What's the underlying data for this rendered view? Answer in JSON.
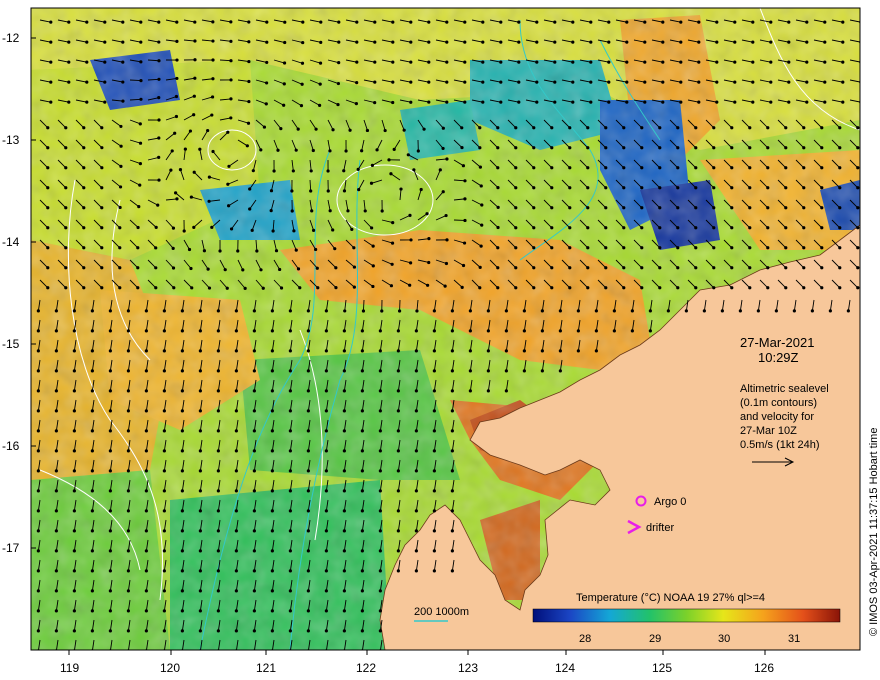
{
  "map": {
    "lat_ticks": [
      "-12",
      "-13",
      "-14",
      "-15",
      "-16",
      "-17"
    ],
    "lon_ticks": [
      "119",
      "120",
      "121",
      "122",
      "123",
      "124",
      "125",
      "126"
    ],
    "date": "27-Mar-2021",
    "time": "10:29Z",
    "sealevel_note": [
      "Altimetric sealevel",
      "(0.1m contours)",
      "and velocity for",
      "27-Mar 10Z",
      "0.5m/s (1kt 24h)"
    ],
    "argo_label": "Argo 0",
    "drifter_label": "drifter",
    "depth_label": "200  1000m",
    "colorbar": {
      "title": "Temperature (°C) NOAA 19 27% ql>=4",
      "ticks": [
        "28",
        "29",
        "30",
        "31"
      ]
    },
    "credit": "© IMOS 03-Apr-2021 11:37:15 Hobart time"
  },
  "colors": {
    "land": "#f7c79a",
    "warm": "#f08a1c",
    "cool": "#1f40a8",
    "argo": "#e81ee8",
    "contour": "#ffffff",
    "isobath": "#33c9c9"
  },
  "icons": [
    "argo-circle-icon",
    "drifter-chevron-icon",
    "velocity-arrow-icon"
  ]
}
